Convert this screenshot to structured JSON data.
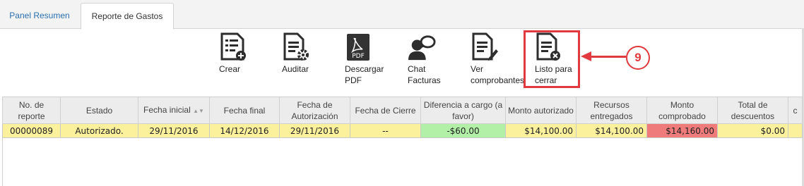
{
  "tabs": [
    {
      "label": "Panel Resumen"
    },
    {
      "label": "Reporte de Gastos"
    }
  ],
  "toolbar": [
    {
      "label": "Crear",
      "icon": "document-add-icon"
    },
    {
      "label": "Auditar",
      "icon": "document-gear-icon"
    },
    {
      "label": "Descargar\nPDF",
      "icon": "pdf-icon"
    },
    {
      "label": "Chat\nFacturas",
      "icon": "chat-user-icon"
    },
    {
      "label": "Ver\ncomprobantes",
      "icon": "document-edit-icon"
    },
    {
      "label": "Listo para\ncerrar",
      "icon": "document-close-icon"
    }
  ],
  "annotation": {
    "badge": "9",
    "color": "#e0393e"
  },
  "table": {
    "headers": [
      "No. de reporte",
      "Estado",
      "Fecha inicial",
      "Fecha final",
      "Fecha de Autorización",
      "Fecha de Cierre",
      "Diferencia a cargo (a favor)",
      "Monto autorizado",
      "Recursos entregados",
      "Monto comprobado",
      "Total de descuentos",
      "c"
    ],
    "rows": [
      [
        "00000089",
        "Autorizado.",
        "29/11/2016",
        "14/12/2016",
        "29/11/2016",
        "--",
        "-$60.00",
        "$14,100.00",
        "$14,100.00",
        "$14,160.00",
        "$0.00",
        ""
      ]
    ]
  },
  "colors": {
    "row": "#fbf19d",
    "positive": "#b2f0a8",
    "negative": "#f07b7b",
    "link": "#2a6fb0"
  }
}
